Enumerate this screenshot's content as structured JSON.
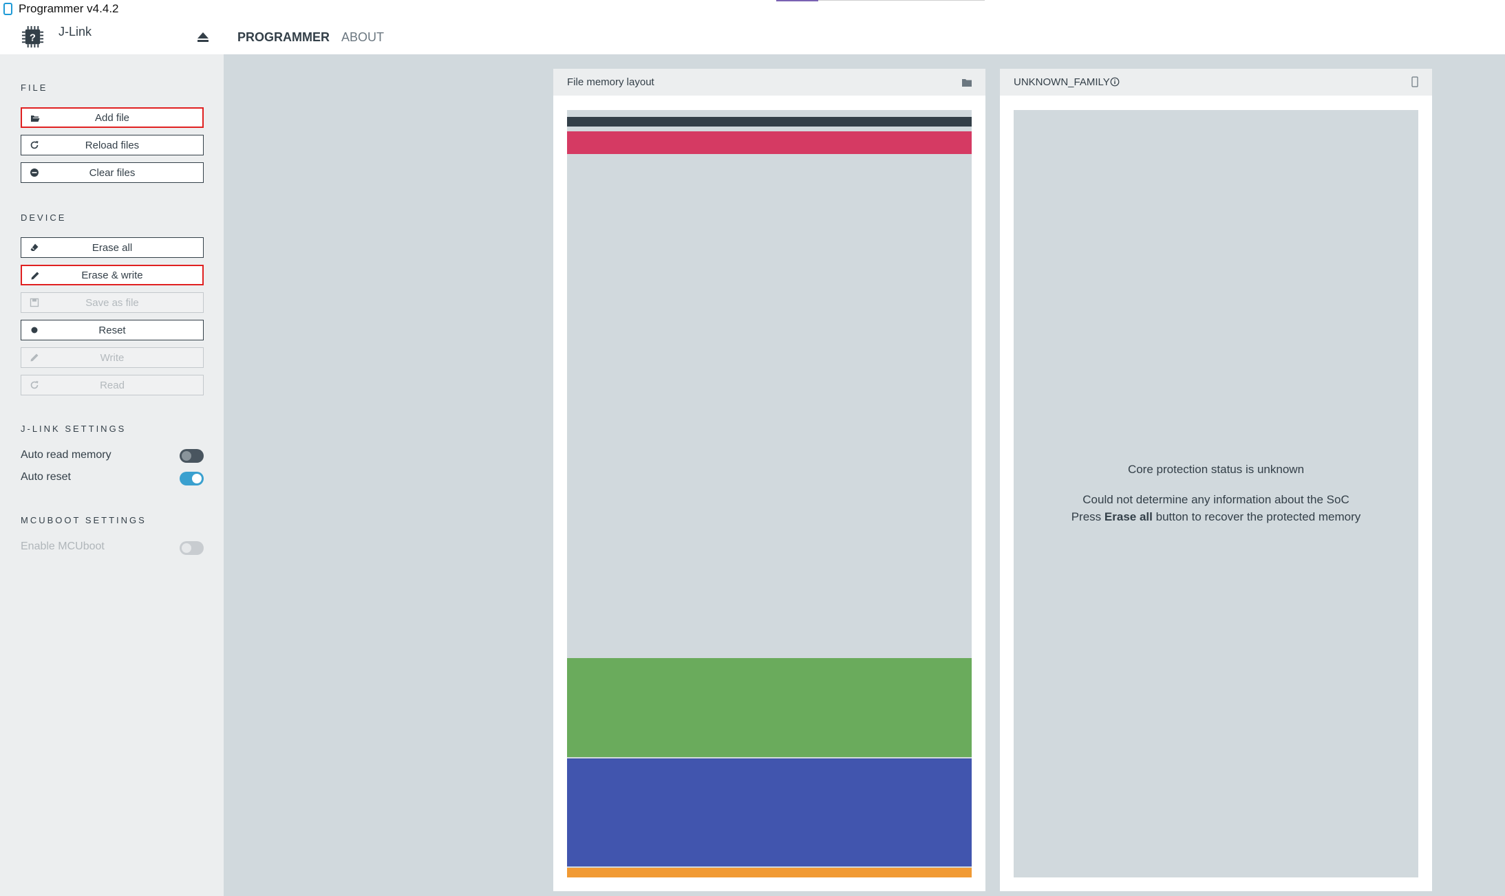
{
  "window": {
    "title": "Programmer v4.4.2"
  },
  "header": {
    "device_name": "J-Link",
    "tabs": [
      {
        "label": "PROGRAMMER",
        "active": true
      },
      {
        "label": "ABOUT",
        "active": false
      }
    ]
  },
  "sidebar": {
    "file": {
      "title": "FILE",
      "buttons": [
        {
          "label": "Add file",
          "icon": "folder-open-icon",
          "highlighted": true
        },
        {
          "label": "Reload files",
          "icon": "refresh-icon"
        },
        {
          "label": "Clear files",
          "icon": "minus-circle-icon"
        }
      ]
    },
    "device": {
      "title": "DEVICE",
      "buttons": [
        {
          "label": "Erase all",
          "icon": "eraser-icon"
        },
        {
          "label": "Erase & write",
          "icon": "pencil-icon",
          "highlighted": true
        },
        {
          "label": "Save as file",
          "icon": "save-icon",
          "disabled": true
        },
        {
          "label": "Reset",
          "icon": "dot-icon"
        },
        {
          "label": "Write",
          "icon": "pencil-icon",
          "disabled": true
        },
        {
          "label": "Read",
          "icon": "refresh-icon",
          "disabled": true
        }
      ]
    },
    "jlink_settings": {
      "title": "J-LINK SETTINGS",
      "auto_read_memory": {
        "label": "Auto read memory",
        "on": false
      },
      "auto_reset": {
        "label": "Auto reset",
        "on": true
      }
    },
    "mcuboot_settings": {
      "title": "MCUBOOT SETTINGS",
      "enable_mcuboot": {
        "label": "Enable MCUboot",
        "on": false,
        "disabled": true
      }
    }
  },
  "file_panel": {
    "title": "File memory layout",
    "regions_colors": [
      "#333f48",
      "#d53a63",
      "#d1d9dd",
      "#6aab5c",
      "#4155ae",
      "#f19a34"
    ]
  },
  "device_panel": {
    "title": "UNKNOWN_FAMILY",
    "status_line": "Core protection status is unknown",
    "info_line": "Could not determine any information about the SoC",
    "press_prefix": "Press",
    "press_bold": "Erase all",
    "press_suffix": "button to recover the protected memory"
  },
  "colors": {
    "accent_blue": "#3aa0cf",
    "highlight_red": "#e02020",
    "background": "#d1d9dd"
  }
}
